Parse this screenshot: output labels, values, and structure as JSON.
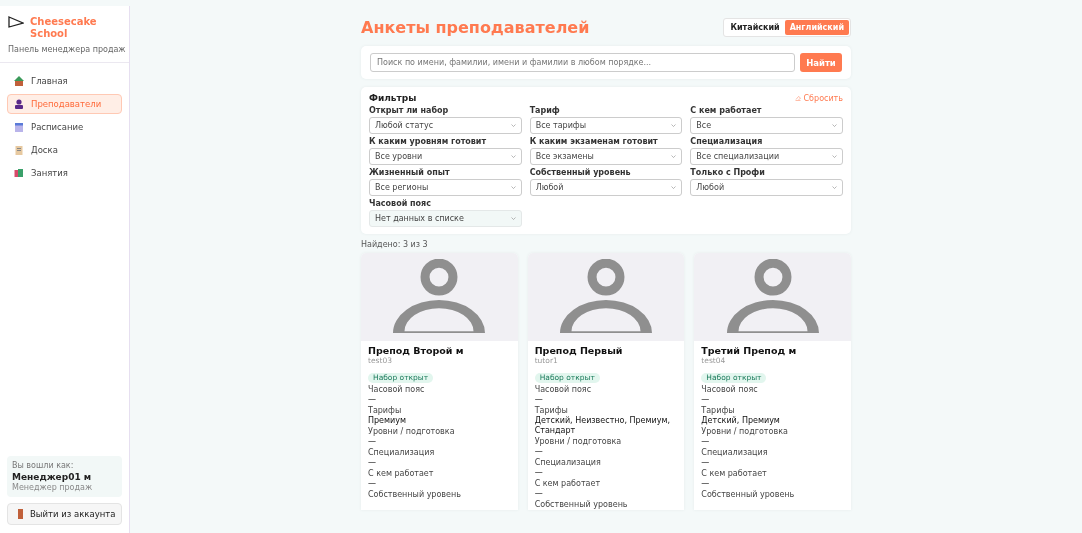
{
  "brand": {
    "name_line1": "Cheesecake",
    "name_line2": "School",
    "subtitle": "Панель менеджера продаж"
  },
  "nav": [
    {
      "label": "Главная",
      "selected": false
    },
    {
      "label": "Преподаватели",
      "selected": true
    },
    {
      "label": "Расписание",
      "selected": false
    },
    {
      "label": "Доска",
      "selected": false
    },
    {
      "label": "Занятия",
      "selected": false
    }
  ],
  "account": {
    "caption": "Вы вошли как:",
    "name": "Менеджер01 м",
    "role": "Менеджер продаж"
  },
  "logout": "Выйти из аккаунта",
  "title": "Анкеты преподавателей",
  "languages": [
    {
      "label": "Китайский",
      "selected": false
    },
    {
      "label": "Английский",
      "selected": true
    }
  ],
  "search": {
    "placeholder": "Поиск по имени, фамилии, имени и фамилии в любом порядке...",
    "button": "Найти"
  },
  "filters": {
    "title": "Фильтры",
    "reset": "Сбросить",
    "fields": [
      {
        "label": "Открыт ли набор",
        "value": "Любой статус",
        "disabled": false
      },
      {
        "label": "Тариф",
        "value": "Все тарифы",
        "disabled": false
      },
      {
        "label": "С кем работает",
        "value": "Все",
        "disabled": false
      },
      {
        "label": "К каким уровням готовит",
        "value": "Все уровни",
        "disabled": false
      },
      {
        "label": "К каким экзаменам готовит",
        "value": "Все экзамены",
        "disabled": false
      },
      {
        "label": "Специализация",
        "value": "Все специализации",
        "disabled": false
      },
      {
        "label": "Жизненный опыт",
        "value": "Все регионы",
        "disabled": false
      },
      {
        "label": "Собственный уровень",
        "value": "Любой",
        "disabled": false
      },
      {
        "label": "Только с Профи",
        "value": "Любой",
        "disabled": false
      },
      {
        "label": "Часовой пояс",
        "value": "Нет данных в списке",
        "disabled": true
      }
    ]
  },
  "found": "Найдено: 3 из 3",
  "teachers": [
    {
      "name": "Препод Второй м",
      "login": "test03",
      "badge": "Набор открыт",
      "fields": [
        {
          "label": "Часовой пояс",
          "value": "—"
        },
        {
          "label": "Тарифы",
          "value": "Премиум"
        },
        {
          "label": "Уровни / подготовка",
          "value": "—"
        },
        {
          "label": "Специализация",
          "value": "—"
        },
        {
          "label": "С кем работает",
          "value": "—"
        },
        {
          "label": "Собственный уровень"
        }
      ]
    },
    {
      "name": "Препод Первый",
      "login": "tutor1",
      "badge": "Набор открыт",
      "fields": [
        {
          "label": "Часовой пояс",
          "value": "—"
        },
        {
          "label": "Тарифы",
          "value": "Детский, Неизвестно, Премиум, Стандарт"
        },
        {
          "label": "Уровни / подготовка",
          "value": "—"
        },
        {
          "label": "Специализация",
          "value": "—"
        },
        {
          "label": "С кем работает",
          "value": "—"
        },
        {
          "label": "Собственный уровень"
        }
      ]
    },
    {
      "name": "Третий Препод м",
      "login": "test04",
      "badge": "Набор открыт",
      "fields": [
        {
          "label": "Часовой пояс",
          "value": "—"
        },
        {
          "label": "Тарифы",
          "value": "Детский, Премиум"
        },
        {
          "label": "Уровни / подготовка",
          "value": "—"
        },
        {
          "label": "Специализация",
          "value": "—"
        },
        {
          "label": "С кем работает",
          "value": "—"
        },
        {
          "label": "Собственный уровень"
        }
      ]
    }
  ]
}
